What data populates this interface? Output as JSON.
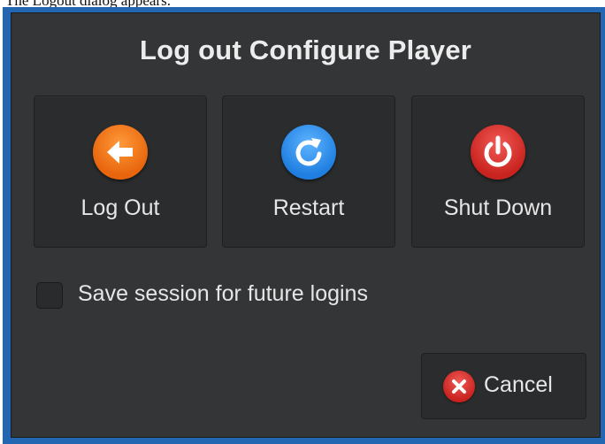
{
  "caption": "The Logout dialog appears.",
  "dialog": {
    "title": "Log out Configure Player",
    "actions": [
      {
        "label": "Log Out",
        "icon": "arrow-left-icon",
        "color": "#e8650c"
      },
      {
        "label": "Restart",
        "icon": "refresh-icon",
        "color": "#1f7fe0"
      },
      {
        "label": "Shut Down",
        "icon": "power-icon",
        "color": "#c8231f"
      }
    ],
    "save_session_label": "Save session for future logins",
    "save_session_checked": false,
    "cancel_label": "Cancel",
    "cancel_icon": "close-icon"
  },
  "colors": {
    "frame": "#2367b3",
    "dialog_bg": "#343536",
    "button_bg": "#2b2c2d",
    "text": "#e6e6e6"
  }
}
